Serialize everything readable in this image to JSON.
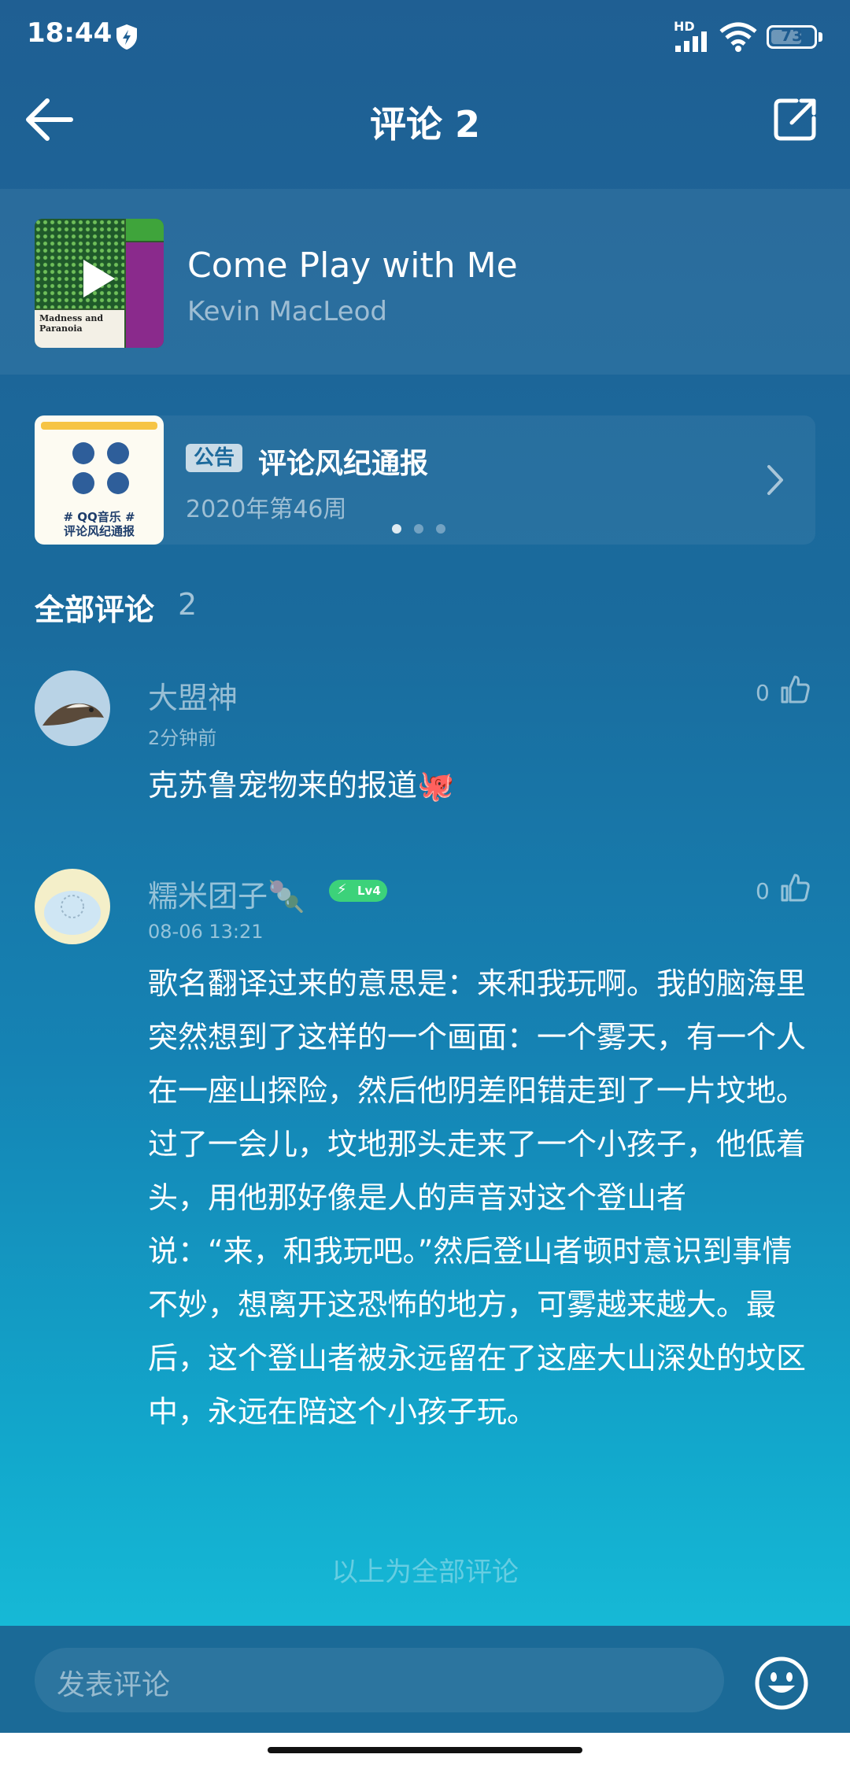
{
  "status_bar": {
    "time": "18:44",
    "hd_label": "HD",
    "battery_level": "73",
    "battery_fraction": 0.73
  },
  "nav": {
    "title": "评论 2"
  },
  "song": {
    "title": "Come Play with Me",
    "artist": "Kevin MacLeod",
    "cover_caption_line1": "Madness and",
    "cover_caption_line2": "Paranoia"
  },
  "notice": {
    "badge": "公告",
    "title": "评论风纪通报",
    "subtitle": "2020年第46周",
    "image_caption_line1": "# QQ音乐 #",
    "image_caption_line2": "评论风纪通报"
  },
  "carousel": {
    "count": 3,
    "active_index": 0
  },
  "comments_section": {
    "title": "全部评论",
    "count": "2"
  },
  "comments": [
    {
      "name": "大盟神",
      "time": "2分钟前",
      "likes": "0",
      "text": "克苏鲁宠物来的报道🐙"
    },
    {
      "name": "糯米团子🍡",
      "level": "Lv4",
      "time": "08-06 13:21",
      "likes": "0",
      "text": "歌名翻译过来的意思是：来和我玩啊。我的脑海里突然想到了这样的一个画面：一个雾天，有一个人在一座山探险，然后他阴差阳错走到了一片坟地。过了一会儿，坟地那头走来了一个小孩子，他低着头，用他那好像是人的声音对这个登山者说：“来，和我玩吧。”然后登山者顿时意识到事情不妙，想离开这恐怖的地方，可雾越来越大。最后，这个登山者被永远留在了这座大山深处的坟区中，永远在陪这个小孩子玩。"
    }
  ],
  "end_text": "以上为全部评论",
  "composer": {
    "placeholder": "发表评论"
  }
}
